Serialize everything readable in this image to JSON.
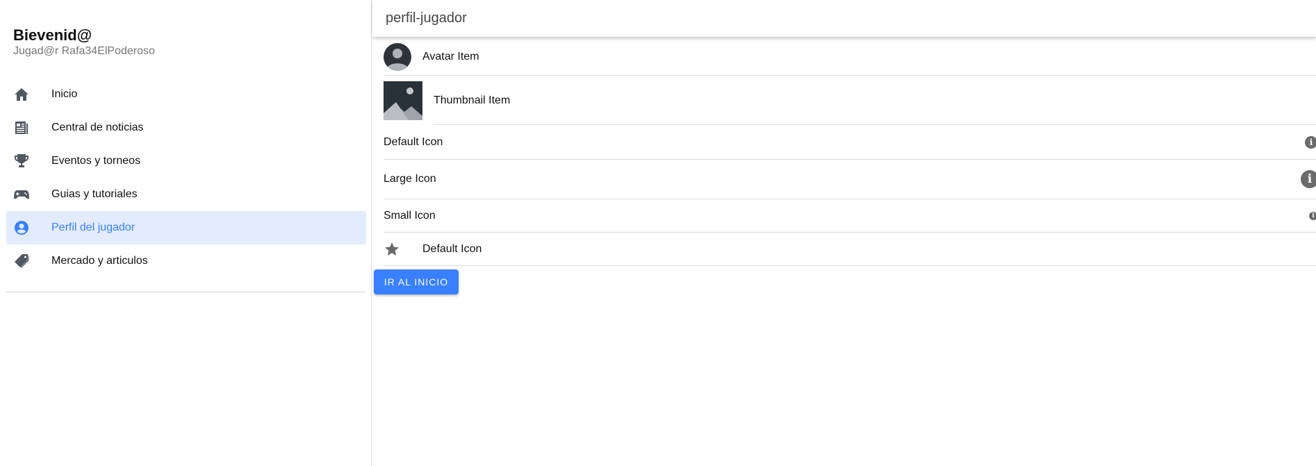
{
  "sidebar": {
    "title": "Bievenid@",
    "subtitle": "Jugad@r Rafa34ElPoderoso",
    "items": [
      {
        "label": "Inicio",
        "icon": "home-icon"
      },
      {
        "label": "Central de noticias",
        "icon": "newspaper-icon"
      },
      {
        "label": "Eventos y torneos",
        "icon": "trophy-icon"
      },
      {
        "label": "Guias y tutoriales",
        "icon": "gamepad-icon"
      },
      {
        "label": "Perfil del jugador",
        "icon": "person-circle-icon",
        "active": true
      },
      {
        "label": "Mercado y articulos",
        "icon": "pricetags-icon"
      }
    ]
  },
  "header": {
    "title": "perfil-jugador"
  },
  "list": {
    "avatar_item": "Avatar Item",
    "thumbnail_item": "Thumbnail Item",
    "default_icon_item": "Default Icon",
    "large_icon_item": "Large Icon",
    "small_icon_item": "Small Icon",
    "star_item": "Default Icon"
  },
  "button": {
    "label": "IR AL INICIO"
  },
  "colors": {
    "accent": "#3880ff",
    "active_bg": "#e3ecfd",
    "icon": "#4f5760"
  }
}
